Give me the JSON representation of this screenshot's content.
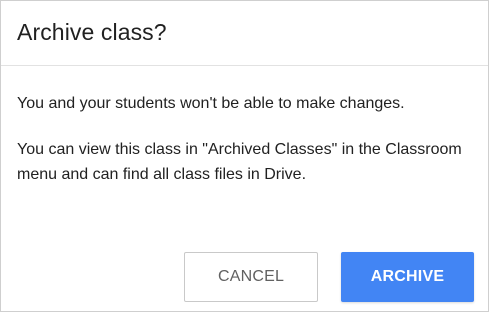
{
  "dialog": {
    "title": "Archive class?",
    "message_1": "You and your students won't be able to make changes.",
    "message_2": "You can view this class in \"Archived Classes\" in the Classroom menu and can find all class files in Drive.",
    "cancel_label": "CANCEL",
    "archive_label": "ARCHIVE",
    "colors": {
      "primary_button": "#4285f4",
      "text": "#212121"
    }
  }
}
